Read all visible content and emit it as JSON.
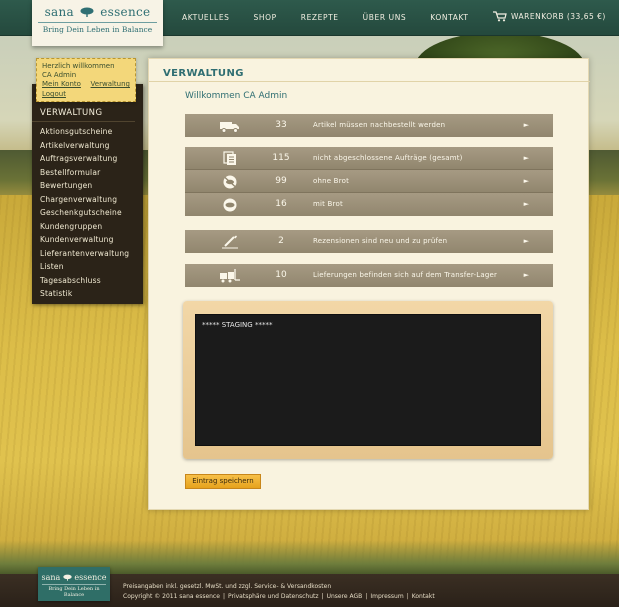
{
  "header": {
    "brand_left": "sana",
    "brand_right": "essence",
    "tagline": "Bring Dein Leben in Balance",
    "nav": [
      "AKTUELLES",
      "SHOP",
      "REZEPTE",
      "ÜBER UNS",
      "KONTAKT"
    ],
    "cart_label": "WARENKORB (33,65 €)"
  },
  "user_box": {
    "greeting": "Herzlich willkommen",
    "name": "CA Admin",
    "my_account": "Mein Konto",
    "admin": "Verwaltung",
    "logout": "Logout"
  },
  "sidebar": {
    "title": "VERWALTUNG",
    "items": [
      "Aktionsgutscheine",
      "Artikelverwaltung",
      "Auftragsverwaltung",
      "Bestellformular",
      "Bewertungen",
      "Chargenverwaltung",
      "Geschenkgutscheine",
      "Kundengruppen",
      "Kundenverwaltung",
      "Lieferantenverwaltung",
      "Listen",
      "Tagesabschluss",
      "Statistik"
    ]
  },
  "main": {
    "title": "VERWALTUNG",
    "welcome": "Willkommen CA Admin",
    "rows": [
      {
        "icon": "truck-icon",
        "count": "33",
        "label": "Artikel müssen nachbestellt werden",
        "arrow": "►"
      },
      {
        "icon": "documents-icon",
        "count": "115",
        "label": "nicht abgeschlossene Aufträge (gesamt)",
        "arrow": "►"
      },
      {
        "icon": "no-bread-icon",
        "count": "99",
        "label": "ohne Brot",
        "arrow": "►"
      },
      {
        "icon": "bread-icon",
        "count": "16",
        "label": "mit Brot",
        "arrow": "►"
      },
      {
        "icon": "pen-icon",
        "count": "2",
        "label": "Rezensionen sind neu und zu prüfen",
        "arrow": "►"
      },
      {
        "icon": "forklift-icon",
        "count": "10",
        "label": "Lieferungen befinden sich auf dem Transfer-Lager",
        "arrow": "►"
      }
    ],
    "board_text": "***** STAGING *****",
    "save_label": "Eintrag speichern"
  },
  "footer": {
    "brand_left": "sana",
    "brand_right": "essence",
    "tagline": "Bring Dein Leben in Balance",
    "line1": "Preisangaben inkl. gesetzl. MwSt. und zzgl. Service- & Versandkosten",
    "copyright": "Copyright © 2011 sana essence",
    "links": [
      "Privatsphäre und Datenschutz",
      "Unsere AGB",
      "Impressum",
      "Kontakt"
    ],
    "separator": "|"
  },
  "colors": {
    "header_green": "#2e5a4c",
    "accent_teal": "#2f6e72",
    "row_taupe": "#9d927b",
    "button_orange": "#f0b232",
    "sidebar_dark": "#2b2318"
  }
}
